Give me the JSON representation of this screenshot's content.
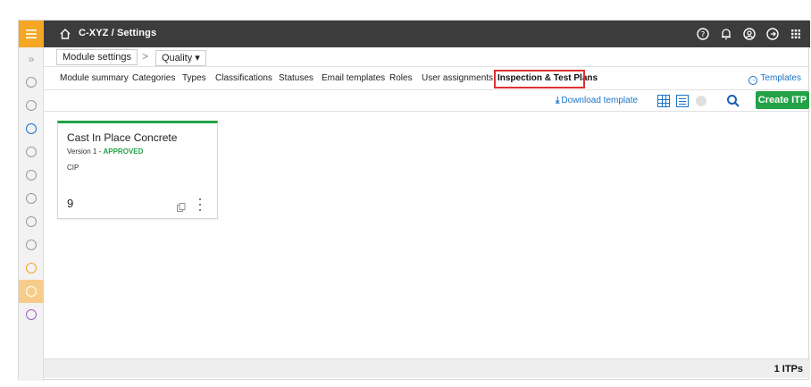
{
  "topbar": {
    "breadcrumb": "C-XYZ / Settings",
    "icons": [
      "help-icon",
      "bell-icon",
      "user-icon",
      "sign-out-icon",
      "apps-grid-icon"
    ]
  },
  "subheader": {
    "module_settings_label": "Module settings",
    "quality_label": "Quality ▾"
  },
  "tabs": [
    {
      "label": "Module summary"
    },
    {
      "label": "Categories"
    },
    {
      "label": "Types"
    },
    {
      "label": "Classifications"
    },
    {
      "label": "Statuses"
    },
    {
      "label": "Email templates"
    },
    {
      "label": "Roles"
    },
    {
      "label": "User assignments"
    },
    {
      "label": "Inspection & Test Plans",
      "active": true
    }
  ],
  "templates_link": "Templates",
  "toolbar": {
    "download_label": "Download template",
    "create_label": "Create ITP"
  },
  "card": {
    "title": "Cast In Place Concrete",
    "version": "Version 1 - ",
    "status": "APPROVED",
    "code": "CIP",
    "count": "9"
  },
  "footer": {
    "count_label": "1 ITPs"
  },
  "colors": {
    "accent": "#f5a623",
    "primary_green": "#23a247",
    "link_blue": "#1a73c8",
    "highlight_red": "#e03131",
    "topbar": "#3c3c3c"
  }
}
